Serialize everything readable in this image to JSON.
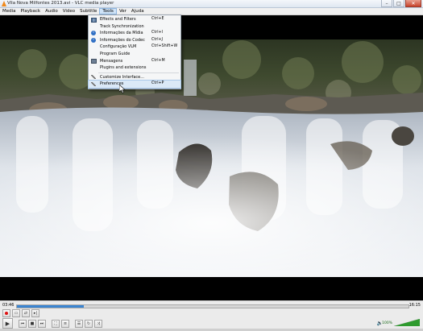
{
  "window": {
    "title": "Vila Nova Milfontes 2013.avi - VLC media player",
    "buttons": {
      "minimize": "–",
      "maximize": "□",
      "close": "✕"
    }
  },
  "menubar": [
    {
      "label": "Media"
    },
    {
      "label": "Playback"
    },
    {
      "label": "Audio"
    },
    {
      "label": "Video"
    },
    {
      "label": "Subtitle"
    },
    {
      "label": "Tools"
    },
    {
      "label": "Ver"
    },
    {
      "label": "Ajuda"
    }
  ],
  "tools_menu": {
    "items": [
      {
        "label": "Effects and Filters",
        "shortcut": "Ctrl+E",
        "icon": "equalizer-icon"
      },
      {
        "label": "Track Synchronization",
        "shortcut": "",
        "icon": ""
      },
      {
        "label": "Informações da Mídia",
        "shortcut": "Ctrl+I",
        "icon": "info-icon"
      },
      {
        "label": "Informações do Codec",
        "shortcut": "Ctrl+J",
        "icon": "info-icon"
      },
      {
        "label": "Configuração VLM",
        "shortcut": "Ctrl+Shift+W",
        "icon": ""
      },
      {
        "label": "Program Guide",
        "shortcut": "",
        "icon": ""
      },
      {
        "label": "Mensagens",
        "shortcut": "Ctrl+M",
        "icon": "messages-icon"
      },
      {
        "label": "Plugins and extensions",
        "shortcut": "",
        "icon": ""
      },
      {
        "label": "Customize Interface...",
        "shortcut": "",
        "icon": "tools-icon"
      },
      {
        "label": "Preferences",
        "shortcut": "Ctrl+P",
        "icon": "tools-icon",
        "highlighted": true
      }
    ]
  },
  "player": {
    "time_current": "03:46",
    "time_total": "16:15",
    "progress": 0.17,
    "volume_percent": "100%",
    "volume_level": 1.0
  },
  "colors": {
    "accent": "#3b85d1",
    "record": "#dd1111",
    "volume": "#2e9b2e"
  }
}
